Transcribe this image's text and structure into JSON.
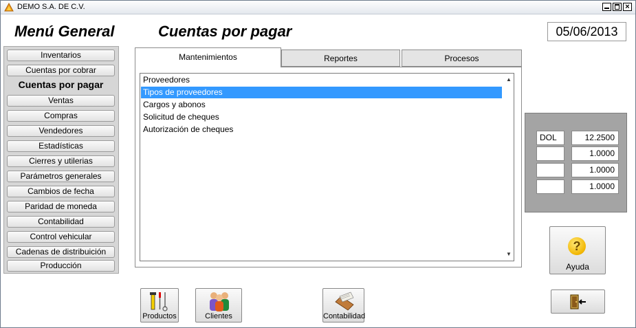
{
  "window": {
    "title": "DEMO  S.A. DE C.V.",
    "minimize": "_",
    "maximize": "□",
    "close": "×"
  },
  "header": {
    "menu_title": "Menú General",
    "section_title": "Cuentas por pagar",
    "date": "05/06/2013"
  },
  "menu": {
    "items": [
      "Inventarios",
      "Cuentas por cobrar",
      "Cuentas por pagar",
      "Ventas",
      "Compras",
      "Vendedores",
      "Estadísticas",
      "Cierres y utilerias",
      "Parámetros generales",
      "Cambios de fecha",
      "Paridad de moneda",
      "Contabilidad",
      "Control vehicular",
      "Cadenas de distribuición",
      "Producción"
    ],
    "active_index": 2
  },
  "tabs": [
    "Mantenimientos",
    "Reportes",
    "Procesos"
  ],
  "list": {
    "items": [
      "Proveedores",
      "Tipos de proveedores",
      "Cargos y abonos",
      "Solicitud de cheques",
      "Autorización de cheques"
    ],
    "selected_index": 1,
    "scroll_up": "▲",
    "scroll_down": "▼"
  },
  "rates": [
    {
      "code": "DOL",
      "value": "12.2500"
    },
    {
      "code": "",
      "value": "1.0000"
    },
    {
      "code": "",
      "value": "1.0000"
    },
    {
      "code": "",
      "value": "1.0000"
    }
  ],
  "buttons": {
    "help": "Ayuda",
    "help_glyph": "?",
    "products": "Productos",
    "clients": "Clientes",
    "accounting": "Contabilidad"
  },
  "colors": {
    "selection": "#3399ff",
    "rate_panel": "#a4a4a4",
    "help_icon": "#f2b600"
  }
}
